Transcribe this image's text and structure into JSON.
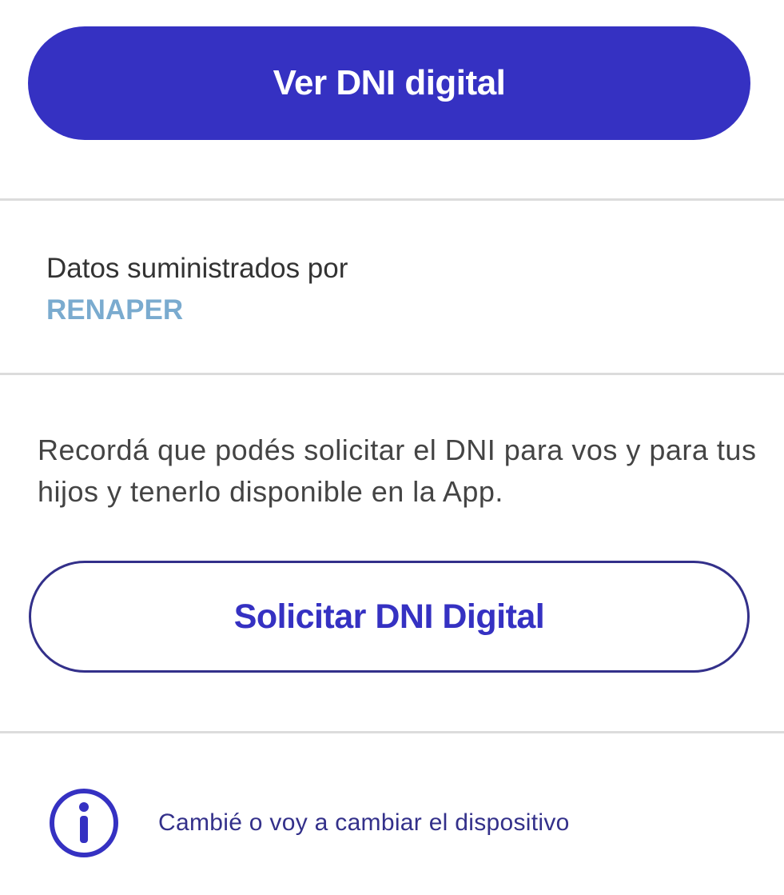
{
  "primary_action": {
    "label": "Ver DNI digital"
  },
  "provider": {
    "label": "Datos suministrados por",
    "name": "RENAPER"
  },
  "reminder": {
    "text": "Recordá que podés solicitar el DNI para vos y para tus hijos y tenerlo disponible en la App."
  },
  "secondary_action": {
    "label": "Solicitar DNI Digital"
  },
  "device_change": {
    "icon": "info-icon",
    "label": "Cambié o voy a cambiar el dispositivo"
  },
  "colors": {
    "primary": "#3531c2",
    "provider_accent": "#7aabcf",
    "outline": "#33308a",
    "divider": "#dcdcdc"
  }
}
